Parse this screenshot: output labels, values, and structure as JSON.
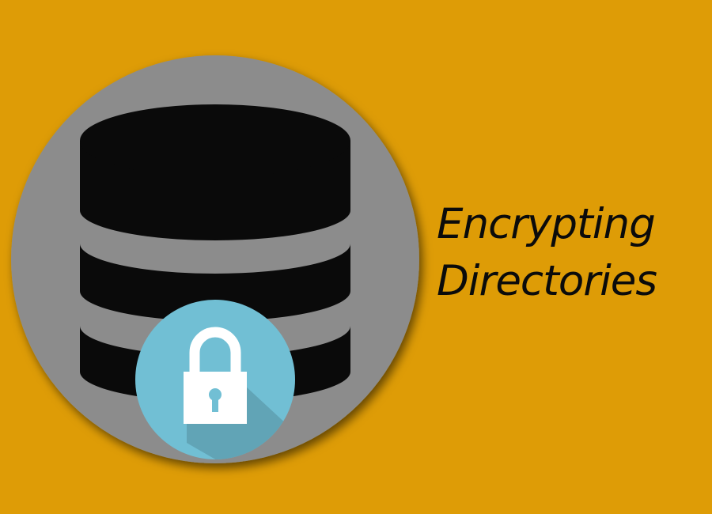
{
  "colors": {
    "background": "#DE9C06",
    "circle": "#8C8C8C",
    "database": "#0A0A0A",
    "lock_badge": "#71BFD4",
    "lock_shadow": "#5E9FB0",
    "lock_body": "#FFFFFF",
    "title_text": "#0B0B0B"
  },
  "icons": {
    "database": "database-icon",
    "lock": "padlock-icon"
  },
  "title": {
    "line1": "Encrypting",
    "line2": "Directories"
  }
}
